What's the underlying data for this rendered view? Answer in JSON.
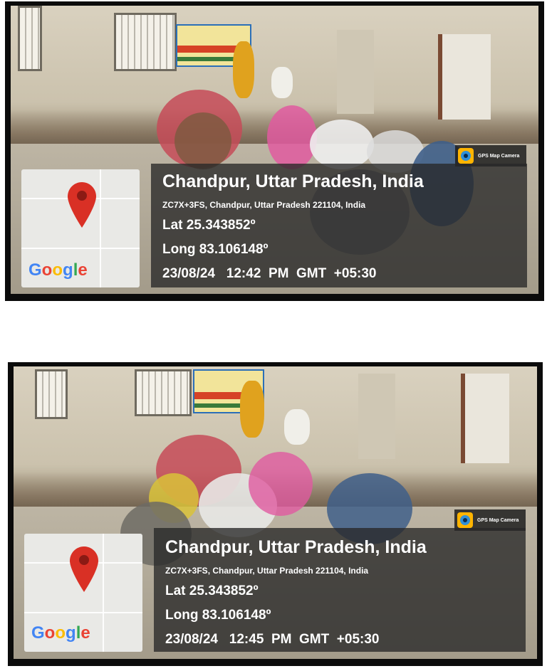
{
  "photos": [
    {
      "badge_label": "GPS Map Camera",
      "map_logo": "Google",
      "location_title": "Chandpur, Uttar Pradesh, India",
      "address": "ZC7X+3FS, Chandpur, Uttar Pradesh 221104, India",
      "latitude": "Lat 25.343852º",
      "longitude": "Long 83.106148º",
      "datetime": "23/08/24   12:42  PM  GMT  +05:30"
    },
    {
      "badge_label": "GPS Map Camera",
      "map_logo": "Google",
      "location_title": "Chandpur, Uttar Pradesh, India",
      "address": "ZC7X+3FS, Chandpur, Uttar Pradesh 221104, India",
      "latitude": "Lat 25.343852º",
      "longitude": "Long 83.106148º",
      "datetime": "23/08/24   12:45  PM  GMT  +05:30"
    }
  ],
  "colors": {
    "pin_red": "#d93025",
    "google_blue": "#4285f4",
    "google_red": "#ea4335",
    "google_yellow": "#fbbc05",
    "google_green": "#34a853"
  }
}
